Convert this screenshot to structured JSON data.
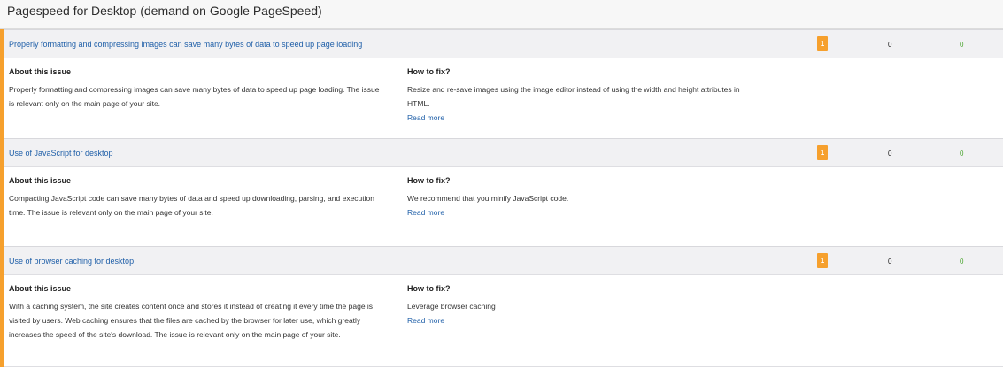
{
  "header": {
    "title": "Pagespeed for Desktop (demand on Google PageSpeed)"
  },
  "issues": [
    {
      "title": "Properly formatting and compressing images can save many bytes of data to speed up page loading",
      "badge": "1",
      "count_mid": "0",
      "count_right": "0",
      "about_heading": "About this issue",
      "about_text": "Properly formatting and compressing images can save many bytes of data to speed up page loading. The issue is relevant only on the main page of your site.",
      "fix_heading": "How to fix?",
      "fix_text": "Resize and re-save images using the image editor instead of using the width and height attributes in HTML.",
      "read_more": "Read more"
    },
    {
      "title": "Use of JavaScript for desktop",
      "badge": "1",
      "count_mid": "0",
      "count_right": "0",
      "about_heading": "About this issue",
      "about_text": "Compacting JavaScript code can save many bytes of data and speed up downloading, parsing, and execution time. The issue is relevant only on the main page of your site.",
      "fix_heading": "How to fix?",
      "fix_text": "We recommend that you minify JavaScript code.",
      "read_more": "Read more"
    },
    {
      "title": "Use of browser caching for desktop",
      "badge": "1",
      "count_mid": "0",
      "count_right": "0",
      "about_heading": "About this issue",
      "about_text": "With a caching system, the site creates content once and stores it instead of creating it every time the page is visited by users. Web caching ensures that the files are cached by the browser for later use, which greatly increases the speed of the site's download. The issue is relevant only on the main page of your site.",
      "fix_heading": "How to fix?",
      "fix_text": "Leverage browser caching",
      "read_more": "Read more"
    }
  ],
  "colors": {
    "accent": "#f6a02d",
    "link": "#1f5fa8",
    "positive": "#4aa52e"
  }
}
